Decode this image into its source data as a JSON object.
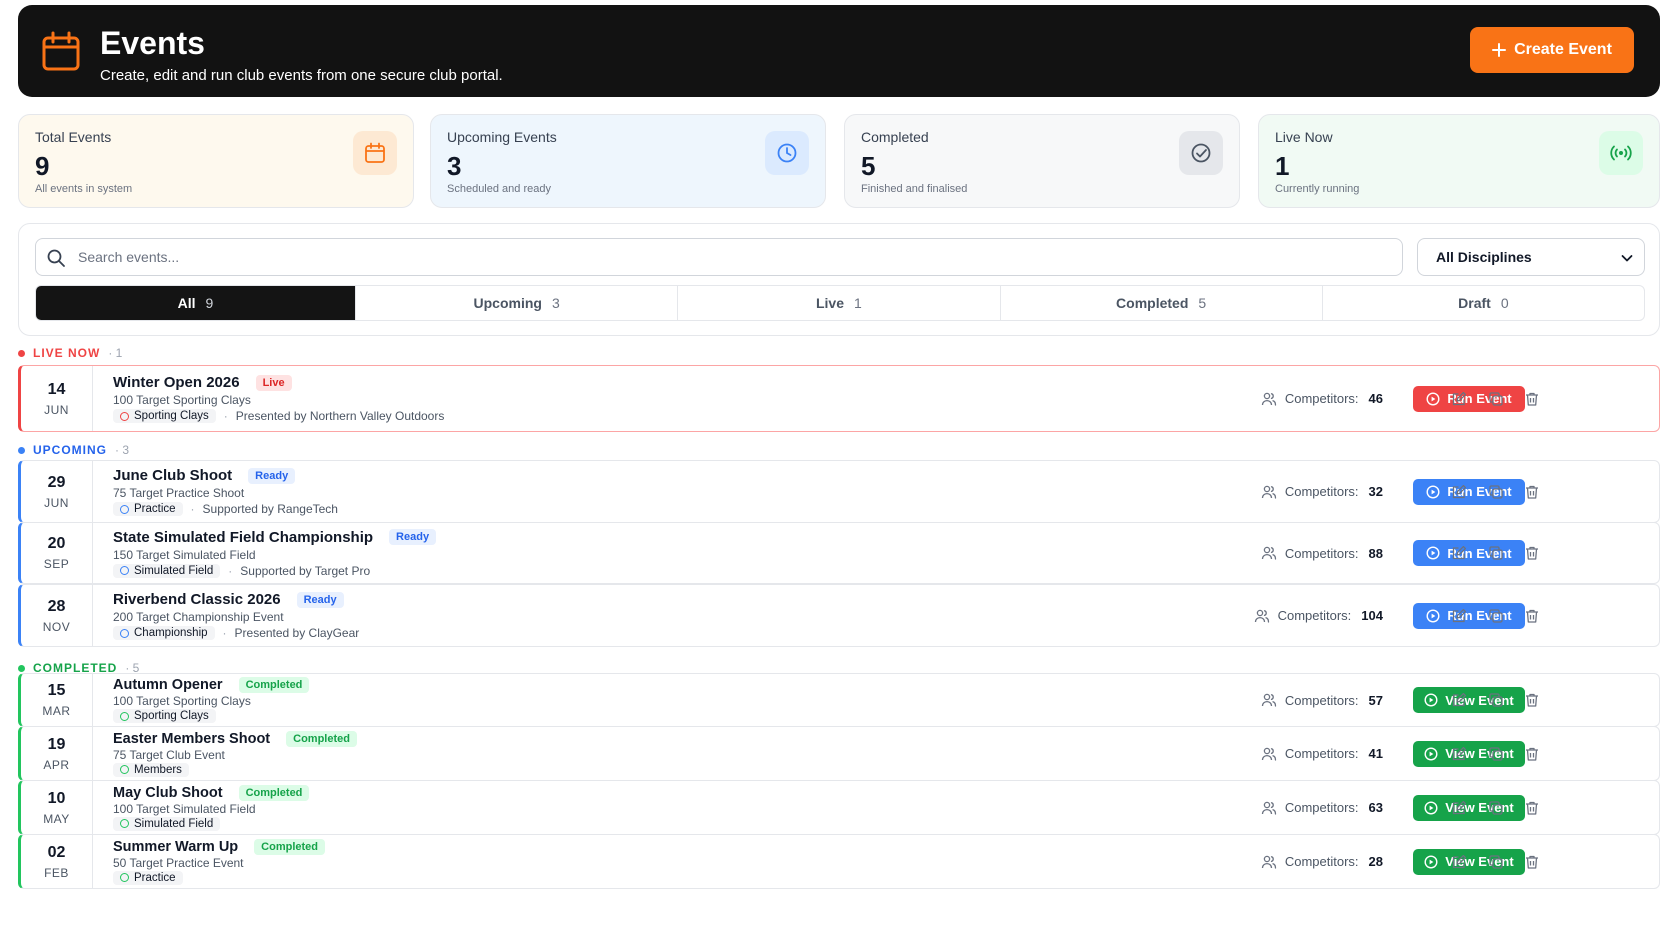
{
  "header": {
    "title": "Events",
    "subtitle": "Create, edit and run club events from one secure club portal.",
    "create_label": "Create Event",
    "accent": "#f97316"
  },
  "stats": [
    {
      "label": "Total Events",
      "value": "9",
      "note": "All events in system",
      "icon": "calendar-icon"
    },
    {
      "label": "Upcoming Events",
      "value": "3",
      "note": "Scheduled and ready",
      "icon": "clock-icon"
    },
    {
      "label": "Completed",
      "value": "5",
      "note": "Finished and finalised",
      "icon": "check-circle-icon"
    },
    {
      "label": "Live Now",
      "value": "1",
      "note": "Currently running",
      "icon": "broadcast-icon"
    }
  ],
  "search": {
    "placeholder": "Search events...",
    "value": ""
  },
  "discipline": {
    "selected": "All Disciplines"
  },
  "tabs": [
    {
      "label": "All",
      "count": "9",
      "active": true
    },
    {
      "label": "Upcoming",
      "count": "3"
    },
    {
      "label": "Live",
      "count": "1"
    },
    {
      "label": "Completed",
      "count": "5"
    },
    {
      "label": "Draft",
      "count": "0"
    }
  ],
  "sections": {
    "live": {
      "label": "LIVE NOW",
      "count": "· 1",
      "color": "#ef4444"
    },
    "upcoming": {
      "label": "UPCOMING",
      "count": "· 3",
      "color": "#3b82f6"
    },
    "completed": {
      "label": "COMPLETED",
      "count": "· 5",
      "color": "#22c55e"
    }
  },
  "competitors_label": "Competitors:",
  "events": [
    {
      "day": "14",
      "month": "JUN",
      "name": "Winter Open 2026",
      "status": "Live",
      "subtitle": "100 Target Sporting Clays",
      "discipline": "Sporting Clays",
      "sponsor": "Presented by Northern Valley Outdoors",
      "competitors": "46",
      "action": "Run Event"
    },
    {
      "day": "29",
      "month": "JUN",
      "name": "June Club Shoot",
      "status": "Ready",
      "subtitle": "75 Target Practice Shoot",
      "discipline": "Practice",
      "sponsor": "Supported by RangeTech",
      "competitors": "32",
      "action": "Run Event"
    },
    {
      "day": "20",
      "month": "SEP",
      "name": "State Simulated Field Championship",
      "status": "Ready",
      "subtitle": "150 Target Simulated Field",
      "discipline": "Simulated Field",
      "sponsor": "Supported by Target Pro",
      "competitors": "88",
      "action": "Run Event"
    },
    {
      "day": "28",
      "month": "NOV",
      "name": "Riverbend Classic 2026",
      "status": "Ready",
      "subtitle": "200 Target Championship Event",
      "discipline": "Championship",
      "sponsor": "Presented by ClayGear",
      "competitors": "104",
      "action": "Run Event"
    },
    {
      "day": "15",
      "month": "MAR",
      "name": "Autumn Opener",
      "status": "Completed",
      "subtitle": "100 Target Sporting Clays",
      "discipline": "Sporting Clays",
      "sponsor": "",
      "competitors": "57",
      "action": "View Event"
    },
    {
      "day": "19",
      "month": "APR",
      "name": "Easter Members Shoot",
      "status": "Completed",
      "subtitle": "75 Target Club Event",
      "discipline": "Members",
      "sponsor": "",
      "competitors": "41",
      "action": "View Event"
    },
    {
      "day": "10",
      "month": "MAY",
      "name": "May Club Shoot",
      "status": "Completed",
      "subtitle": "100 Target Simulated Field",
      "discipline": "Simulated Field",
      "sponsor": "",
      "competitors": "63",
      "action": "View Event"
    },
    {
      "day": "02",
      "month": "FEB",
      "name": "Summer Warm Up",
      "status": "Completed",
      "subtitle": "50 Target Practice Event",
      "discipline": "Practice",
      "sponsor": "",
      "competitors": "28",
      "action": "View Event"
    }
  ]
}
